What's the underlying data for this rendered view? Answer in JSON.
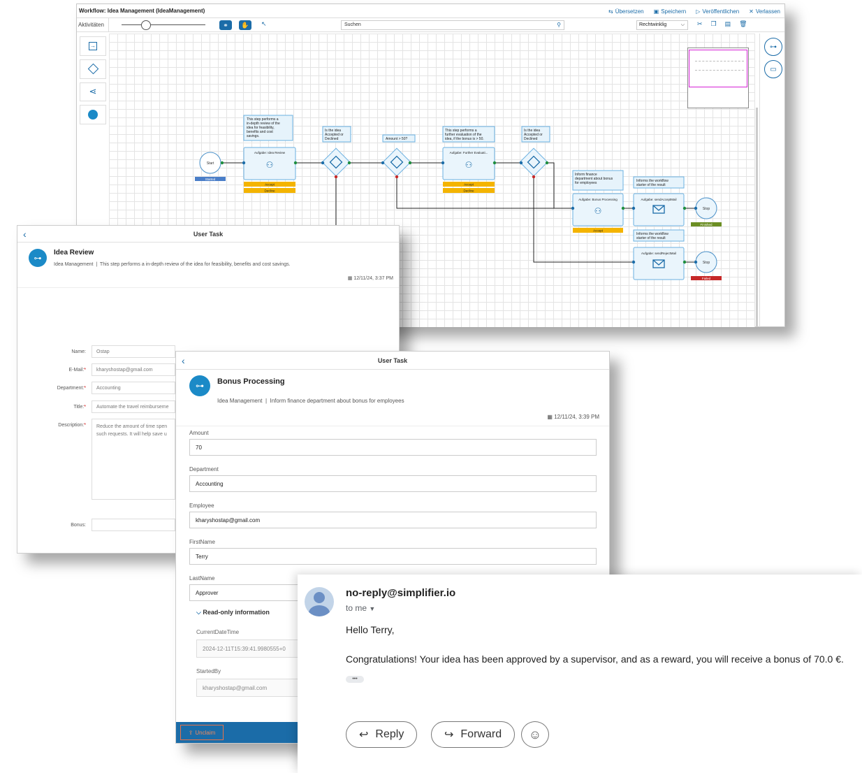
{
  "workflow": {
    "title": "Workflow: Idea Management (IdeaManagement)",
    "actions": {
      "translate": "Übersetzen",
      "save": "Speichern",
      "publish": "Veröffentlichen",
      "leave": "Verlassen"
    },
    "toolbar": {
      "activities_label": "Aktivitäten",
      "search_placeholder": "Suchen",
      "routing": "Rechtwinklig"
    },
    "nodes": {
      "start": "Start",
      "started_badge": "Started",
      "idea_review_note": "This step performs a in-depth review of the idea for feasibility, benefits and cost savings.",
      "idea_review_task": "Aufgabe: Idea Review",
      "accept": "Accept",
      "decline": "Decline",
      "gw1_note": "Is the idea Accepted or Declined",
      "gw2_note": "Amount > 50?",
      "further_note": "This step performs a further evaluation of the idea, if the bonus is > 50.",
      "further_task": "Aufgabe: Further Evaluati...",
      "gw3_note": "Is the idea Accepted or Declined",
      "bonus_note": "Inform finance department about bonus for employees",
      "bonus_task": "Aufgabe: Bonus Processing",
      "inform_note": "Informs the workflow starter of the result",
      "mail_accept_task": "Aufgabe: sendAcceptMail",
      "mail_reject_task": "Aufgabe: sendRejectMail",
      "stop": "Stop",
      "finished_badge": "Finished",
      "failed_badge": "Failed"
    }
  },
  "task1": {
    "header": "User Task",
    "title": "Idea Review",
    "breadcrumb_app": "Idea Management",
    "breadcrumb_desc": "This step performs a in-depth review of the idea for feasibility, benefits and cost savings.",
    "date": "12/11/24, 3:37 PM",
    "fields": {
      "name_label": "Name:",
      "name_value": "Ostap",
      "email_label": "E-Mail:",
      "email_value": "kharyshostap@gmail.com",
      "department_label": "Department:",
      "department_value": "Accounting",
      "title_label": "Title:",
      "title_value": "Automate the travel reimburseme",
      "description_label": "Description:",
      "description_value": "Reduce the amount of time spen such requests. It will help save u",
      "bonus_label": "Bonus:"
    }
  },
  "task2": {
    "header": "User Task",
    "title": "Bonus Processing",
    "breadcrumb_app": "Idea Management",
    "breadcrumb_desc": "Inform finance department about bonus for employees",
    "date": "12/11/24, 3:39 PM",
    "fields": {
      "amount_label": "Amount",
      "amount_value": "70",
      "department_label": "Department",
      "department_value": "Accounting",
      "employee_label": "Employee",
      "employee_value": "kharyshostap@gmail.com",
      "firstname_label": "FirstName",
      "firstname_value": "Terry",
      "lastname_label": "LastName",
      "lastname_value": "Approver"
    },
    "readonly": {
      "section_label": "Read-only information",
      "current_label": "CurrentDateTime",
      "current_value": "2024-12-11T15:39:41.9980555+0",
      "startedby_label": "StartedBy",
      "startedby_value": "kharyshostap@gmail.com"
    },
    "unclaim": "Unclaim"
  },
  "email": {
    "sender": "no-reply@simplifier.io",
    "to": "to me",
    "greeting": "Hello Terry,",
    "body": "Congratulations! Your idea has been approved by a supervisor, and as a reward, you will receive a bonus of 70.0 €.",
    "ellipsis": "•••",
    "reply": "Reply",
    "forward": "Forward"
  },
  "colors": {
    "accent": "#1b6ca8",
    "icon_blue": "#1b8ac7",
    "orange": "#f4b400",
    "green": "#1e8e3e",
    "red": "#c62828"
  }
}
